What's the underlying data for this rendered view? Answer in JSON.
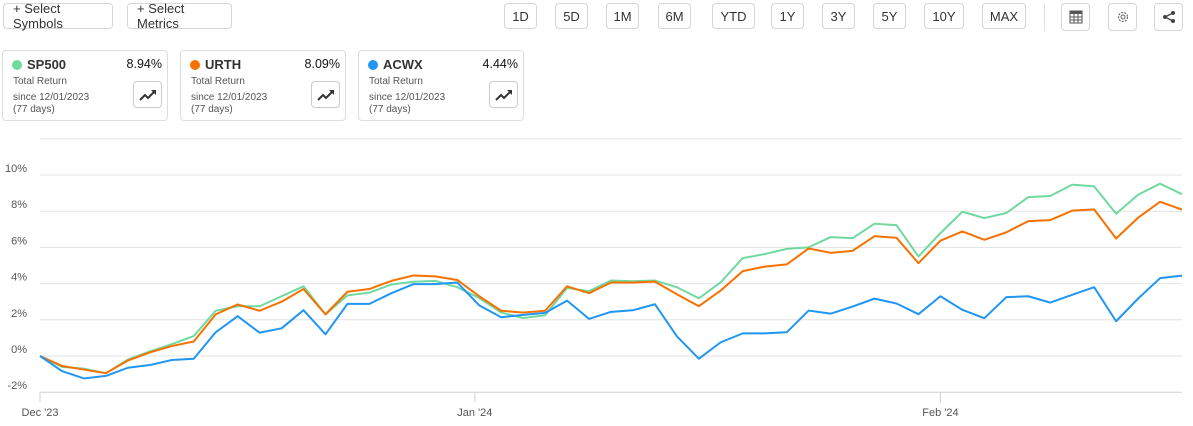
{
  "toolbar": {
    "select_symbols": "+ Select Symbols",
    "select_metrics": "+ Select Metrics",
    "ranges": [
      "1D",
      "5D",
      "1M",
      "6M",
      "YTD",
      "1Y",
      "3Y",
      "5Y",
      "10Y",
      "MAX"
    ],
    "icons": [
      "table-icon",
      "gear-icon",
      "share-icon"
    ]
  },
  "cards": [
    {
      "symbol": "SP500",
      "value": "8.94%",
      "label": "Total Return",
      "since": "since 12/01/2023",
      "days": "(77 days)",
      "color": "#6fd9a0"
    },
    {
      "symbol": "URTH",
      "value": "8.09%",
      "label": "Total Return",
      "since": "since 12/01/2023",
      "days": "(77 days)",
      "color": "#f57200"
    },
    {
      "symbol": "ACWX",
      "value": "4.44%",
      "label": "Total Return",
      "since": "since 12/01/2023",
      "days": "(77 days)",
      "color": "#2196f3"
    }
  ],
  "chart_data": {
    "type": "line",
    "title": "",
    "xlabel": "",
    "ylabel": "",
    "ylim": [
      -2,
      12
    ],
    "yticks": [
      -2,
      0,
      2,
      4,
      6,
      8,
      10
    ],
    "ytick_labels": [
      "-2%",
      "0%",
      "2%",
      "4%",
      "6%",
      "8%",
      "10%"
    ],
    "x_count": 53,
    "xticks": [
      {
        "index": 0,
        "label": "Dec '23"
      },
      {
        "index": 19.8,
        "label": "Jan '24"
      },
      {
        "index": 41.0,
        "label": "Feb '24"
      }
    ],
    "grid": true,
    "series": [
      {
        "name": "SP500",
        "color": "#6fd9a0",
        "values": [
          0,
          -0.6,
          -0.7,
          -0.95,
          -0.2,
          0.25,
          0.65,
          1.1,
          2.5,
          2.75,
          2.75,
          3.3,
          3.85,
          2.3,
          3.35,
          3.5,
          3.95,
          4.1,
          4.15,
          3.8,
          3.2,
          2.4,
          2.1,
          2.25,
          3.76,
          3.58,
          4.17,
          4.13,
          4.17,
          3.8,
          3.19,
          4.08,
          5.41,
          5.63,
          5.92,
          6.0,
          6.57,
          6.51,
          7.31,
          7.23,
          5.5,
          6.79,
          7.97,
          7.62,
          7.9,
          8.78,
          8.84,
          9.47,
          9.37,
          7.86,
          8.91,
          9.52,
          8.94
        ]
      },
      {
        "name": "URTH",
        "color": "#f57200",
        "values": [
          0,
          -0.55,
          -0.75,
          -0.95,
          -0.25,
          0.2,
          0.55,
          0.8,
          2.3,
          2.85,
          2.5,
          3.0,
          3.7,
          2.3,
          3.55,
          3.7,
          4.15,
          4.45,
          4.4,
          4.2,
          3.3,
          2.5,
          2.4,
          2.5,
          3.85,
          3.47,
          4.06,
          4.06,
          4.11,
          3.41,
          2.75,
          3.62,
          4.69,
          4.94,
          5.06,
          5.94,
          5.7,
          5.81,
          6.62,
          6.53,
          5.13,
          6.37,
          6.88,
          6.42,
          6.83,
          7.45,
          7.51,
          8.03,
          8.1,
          6.49,
          7.64,
          8.52,
          8.09
        ]
      },
      {
        "name": "ACWX",
        "color": "#2196f3",
        "values": [
          0,
          -0.83,
          -1.24,
          -1.1,
          -0.65,
          -0.5,
          -0.22,
          -0.15,
          1.31,
          2.2,
          1.29,
          1.53,
          2.53,
          1.2,
          2.88,
          2.88,
          3.47,
          3.97,
          3.97,
          4.06,
          2.8,
          2.14,
          2.27,
          2.38,
          3.06,
          2.05,
          2.44,
          2.53,
          2.86,
          1.09,
          -0.15,
          0.76,
          1.25,
          1.25,
          1.31,
          2.51,
          2.34,
          2.73,
          3.17,
          2.9,
          2.31,
          3.3,
          2.55,
          2.09,
          3.25,
          3.3,
          2.95,
          3.38,
          3.8,
          1.92,
          3.17,
          4.3,
          4.44
        ]
      }
    ]
  }
}
